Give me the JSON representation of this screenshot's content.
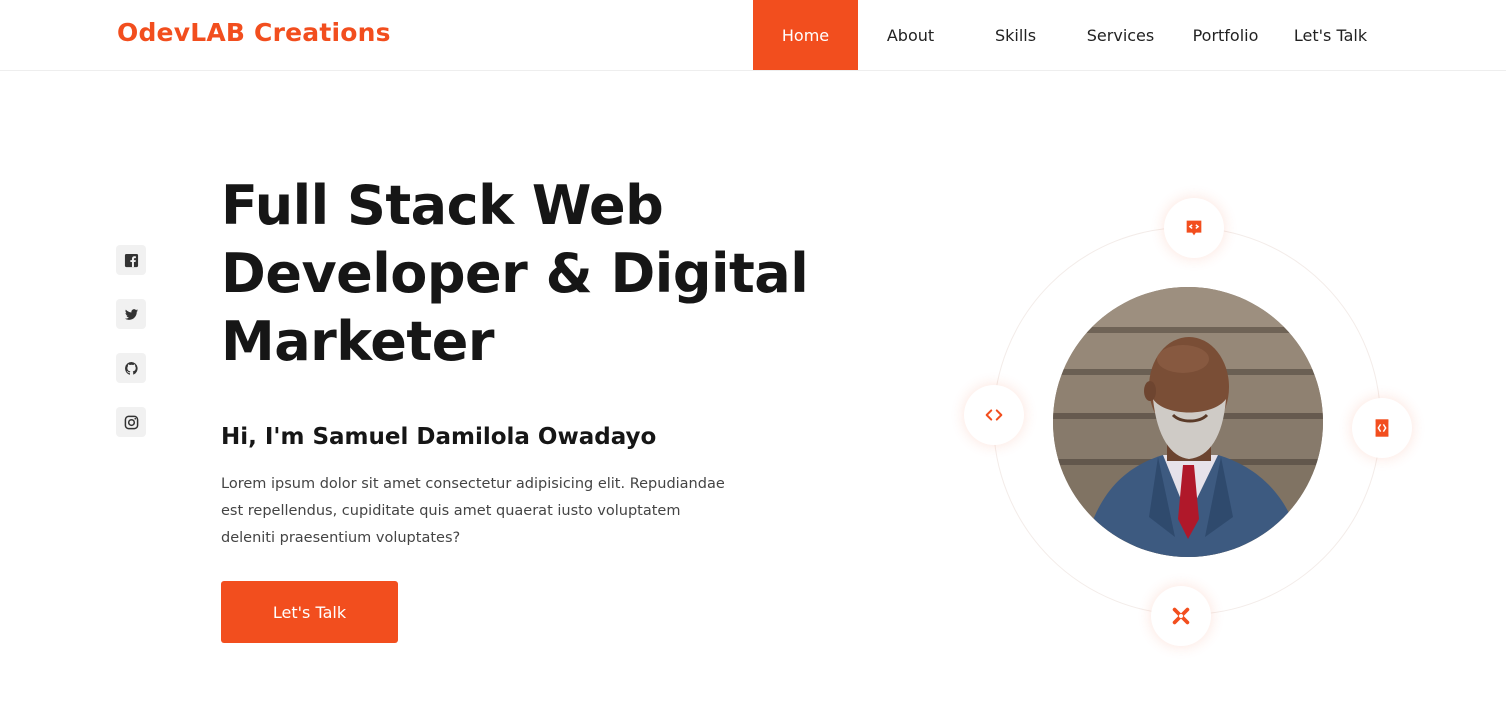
{
  "brand": "OdevLAB Creations",
  "nav": {
    "items": [
      {
        "label": "Home",
        "active": true
      },
      {
        "label": "About"
      },
      {
        "label": "Skills"
      },
      {
        "label": "Services"
      },
      {
        "label": "Portfolio"
      },
      {
        "label": "Let's Talk"
      }
    ]
  },
  "social": [
    "facebook-icon",
    "twitter-icon",
    "github-icon",
    "instagram-icon"
  ],
  "hero": {
    "title_line1": "Full Stack Web",
    "title_line2": "Developer & Digital",
    "title_line3": "Marketer",
    "greeting": "Hi, I'm Samuel Damilola Owadayo",
    "text_line1": "Lorem ipsum dolor sit amet consectetur adipisicing elit. Repudiandae",
    "text_line2": "est repellendus, cupiditate quis amet quaerat iusto voluptatem",
    "text_line3": "deleniti praesentium voluptates?",
    "cta": "Let's Talk"
  },
  "colors": {
    "accent": "#f24e1e",
    "text": "#161616"
  }
}
